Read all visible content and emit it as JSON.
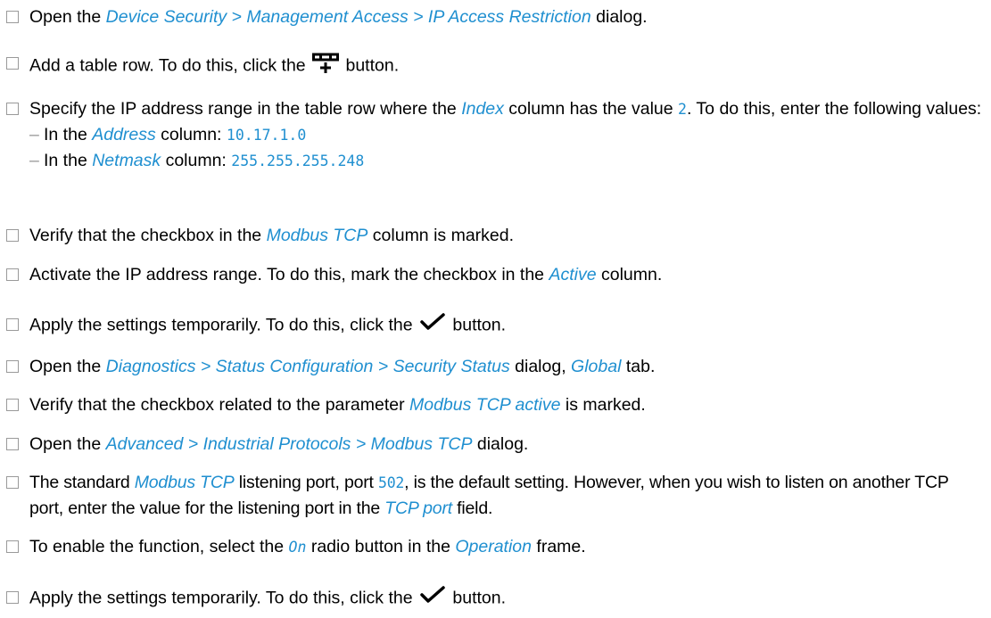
{
  "steps": [
    {
      "p1": "Open the ",
      "link": "Device Security > Management Access > IP Access Restriction",
      "p2": " dialog."
    },
    {
      "p1": "Add a table row. To do this, click the ",
      "icon": "add-table-row-icon",
      "p2": " button."
    },
    {
      "p1": "Specify the IP address range in the table row where the ",
      "link": "Index",
      "p2": " column has the value ",
      "code": "2",
      "p3": ". To do this, enter the following values:",
      "subs": [
        {
          "p1": "In the ",
          "link": "Address",
          "p2": " column: ",
          "code": "10.17.1.0"
        },
        {
          "p1": "In the ",
          "link": "Netmask",
          "p2": " column: ",
          "code": "255.255.255.248"
        }
      ]
    },
    {
      "p1": "Verify that the checkbox in the ",
      "link": "Modbus TCP",
      "p2": " column is marked."
    },
    {
      "p1": "Activate the IP address range. To do this, mark the checkbox in the ",
      "link": "Active",
      "p2": " column."
    },
    {
      "p1": "Apply the settings temporarily. To do this, click the ",
      "icon": "checkmark-icon",
      "p2": " button."
    },
    {
      "p1": "Open the ",
      "link": "Diagnostics > Status Configuration > Security Status",
      "p2": " dialog, ",
      "link2": "Global",
      "p3": " tab."
    },
    {
      "p1": "Verify that the checkbox related to the parameter ",
      "link": "Modbus TCP active",
      "p2": " is marked."
    },
    {
      "p1": "Open the ",
      "link": "Advanced > Industrial Protocols > Modbus TCP",
      "p2": " dialog."
    },
    {
      "p1": "The standard ",
      "link": "Modbus TCP",
      "p2": " listening port, port ",
      "code": "502",
      "p3": ", is the default setting. However, when you wish to listen on another TCP port, enter the value for the listening port in the ",
      "link2": "TCP port",
      "p4": " field."
    },
    {
      "p1": "To enable the function, select the ",
      "code": "On",
      "p2": " radio button in the ",
      "link": "Operation",
      "p3": " frame."
    },
    {
      "p1": "Apply the settings temporarily. To do this, click the ",
      "icon": "checkmark-icon",
      "p2": " button."
    }
  ],
  "colors": {
    "link": "#1f8fd0",
    "checkbox_border": "#9a9a9a"
  }
}
